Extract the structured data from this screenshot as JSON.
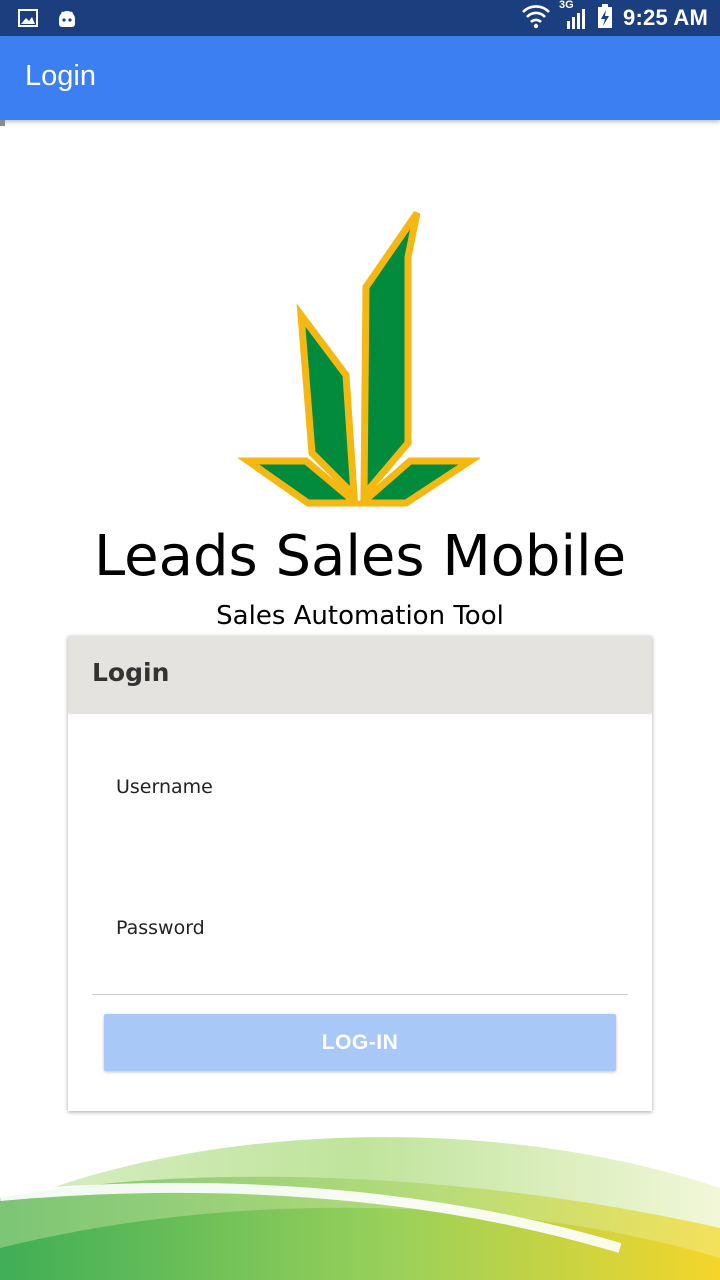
{
  "status_bar": {
    "time": "9:25 AM",
    "network_label": "3G",
    "icons": [
      "image-icon",
      "android-icon",
      "wifi-icon",
      "signal-icon",
      "battery-icon"
    ]
  },
  "app_bar": {
    "title": "Login"
  },
  "branding": {
    "app_name": "Leads Sales Mobile",
    "subtitle": "Sales Automation Tool"
  },
  "login_card": {
    "header": "Login",
    "username": {
      "label": "Username",
      "value": ""
    },
    "password": {
      "label": "Password",
      "value": ""
    },
    "submit_label": "LOG-IN"
  },
  "colors": {
    "status_bar": "#1b3f7e",
    "app_bar": "#3b7ff2",
    "logo_green": "#028a3d",
    "logo_gold": "#f5b812",
    "button_disabled": "#a8c8f8"
  }
}
